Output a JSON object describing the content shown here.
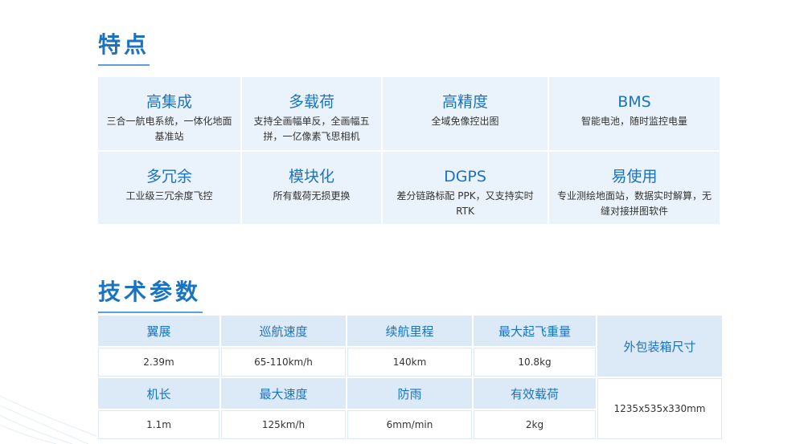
{
  "sections": {
    "features_title": "特点",
    "specs_title": "技术参数"
  },
  "features": [
    {
      "title": "高集成",
      "desc": "三合一航电系统，一体化地面基准站"
    },
    {
      "title": "多载荷",
      "desc": "支持全画幅单反，全画幅五拼，一亿像素飞思相机"
    },
    {
      "title": "高精度",
      "desc": "全域免像控出图"
    },
    {
      "title": "BMS",
      "desc": "智能电池，随时监控电量"
    },
    {
      "title": "多冗余",
      "desc": "工业级三冗余度飞控"
    },
    {
      "title": "模块化",
      "desc": "所有载荷无损更换"
    },
    {
      "title": "DGPS",
      "desc": "差分链路标配 PPK，又支持实时 RTK"
    },
    {
      "title": "易使用",
      "desc": "专业测绘地面站，数据实时解算，无缝对接拼图软件"
    }
  ],
  "specs": {
    "row1_heads": [
      "翼展",
      "巡航速度",
      "续航里程",
      "最大起飞重量"
    ],
    "row1_values": [
      "2.39m",
      "65-110km/h",
      "140km",
      "10.8kg"
    ],
    "row2_heads": [
      "机长",
      "最大速度",
      "防雨",
      "有效载荷"
    ],
    "row2_values": [
      "1.1m",
      "125km/h",
      "6mm/min",
      "2kg"
    ],
    "size_head": "外包装箱尺寸",
    "size_value": "1235x535x330mm"
  }
}
